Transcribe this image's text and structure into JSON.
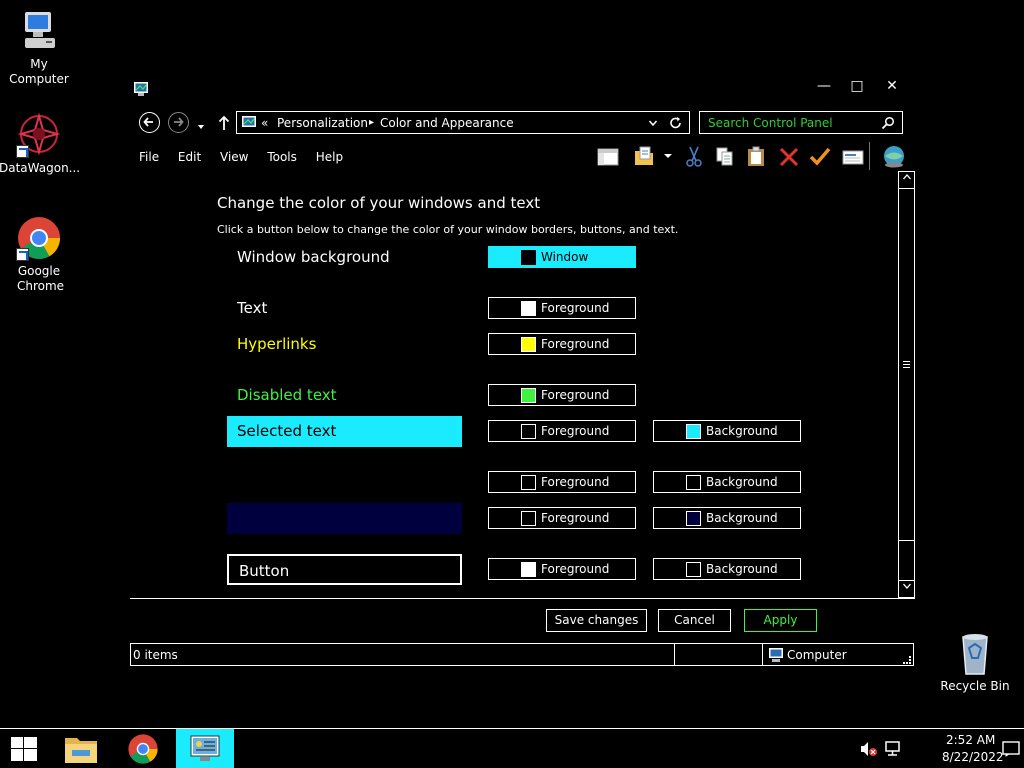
{
  "desktop": {
    "icons": [
      {
        "label": "My Computer"
      },
      {
        "label": "DataWagon..."
      },
      {
        "label": "Google Chrome"
      },
      {
        "label": "Recycle Bin"
      }
    ]
  },
  "window": {
    "caption": {
      "minimize": "—",
      "maximize": "□",
      "close": "✕"
    },
    "address": {
      "overflow": "«",
      "crumbs": [
        "Personalization",
        "Color and Appearance"
      ],
      "separator": "▸"
    },
    "search": {
      "placeholder": "Search Control Panel"
    },
    "menu": [
      "File",
      "Edit",
      "View",
      "Tools",
      "Help"
    ],
    "content": {
      "heading": "Change the color of your windows and text",
      "subheading": "Click a button below to change the color of your window borders, buttons, and text.",
      "rows": [
        {
          "label": "Window background",
          "color": "#ffffff",
          "label_bg": "#000000",
          "buttons": [
            {
              "text": "Window",
              "swatch": "#000000",
              "bg": "#1aebff",
              "text_color": "#000000"
            }
          ]
        },
        {
          "label": "Text",
          "color": "#ffffff",
          "buttons": [
            {
              "text": "Foreground",
              "swatch": "#ffffff"
            }
          ]
        },
        {
          "label": "Hyperlinks",
          "color": "#ffff00",
          "buttons": [
            {
              "text": "Foreground",
              "swatch": "#ffff00"
            }
          ]
        },
        {
          "label": "Disabled text",
          "color": "#3ff23f",
          "buttons": [
            {
              "text": "Foreground",
              "swatch": "#3ff23f"
            }
          ]
        },
        {
          "label": "Selected text",
          "color": "#000000",
          "label_bg": "#1aebff",
          "buttons": [
            {
              "text": "Foreground",
              "swatch": "#000000"
            },
            {
              "text": "Background",
              "swatch": "#1aebff"
            }
          ]
        },
        {
          "label": "",
          "color": "#000000",
          "buttons": [
            {
              "text": "Foreground",
              "swatch": "#000000"
            },
            {
              "text": "Background",
              "swatch": "#000000"
            }
          ]
        },
        {
          "label": "",
          "color": "#000000",
          "label_bg": "#00003f",
          "buttons": [
            {
              "text": "Foreground",
              "swatch": "#000000"
            },
            {
              "text": "Background",
              "swatch": "#00003f"
            }
          ]
        },
        {
          "label": "Button",
          "color": "#ffffff",
          "buttons": [
            {
              "text": "Foreground",
              "swatch": "#ffffff"
            },
            {
              "text": "Background",
              "swatch": "#000000"
            }
          ]
        }
      ]
    },
    "footer": {
      "save": "Save changes",
      "cancel": "Cancel",
      "apply": "Apply"
    },
    "status": {
      "items": "0 items",
      "location": "Computer"
    }
  },
  "taskbar": {
    "apps": [
      "start-icon",
      "file-explorer-icon",
      "chrome-icon",
      "control-panel-icon"
    ],
    "clock": {
      "time": "2:52 AM",
      "date": "8/22/2022"
    }
  },
  "colors": {
    "accent": "#1aebff",
    "apply": "#3ff23f",
    "hyperlink": "#ffff00"
  }
}
